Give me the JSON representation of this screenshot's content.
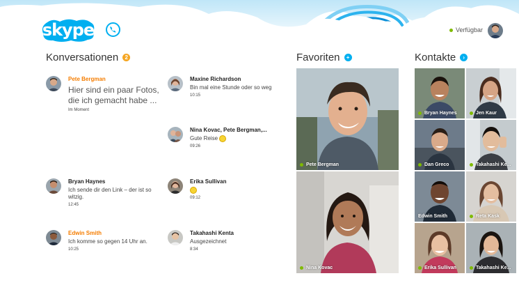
{
  "app": {
    "logo_text": "skype"
  },
  "header": {
    "status_label": "Verfügbar"
  },
  "conversations": {
    "title": "Konversationen",
    "badge": "2",
    "items": [
      {
        "name": "Pete Bergman",
        "message": "Hier sind ein paar Fotos, die ich gemacht habe ...",
        "time": "Im Moment"
      },
      {
        "name": "Maxine Richardson",
        "message": "Bin mal eine Stunde oder so weg",
        "time": "10:15"
      },
      {
        "name": "Nina Kovac, Pete Bergman,...",
        "message": "Gute Reise",
        "time": "09:26"
      },
      {
        "name": "Bryan Haynes",
        "message": "Ich sende dir den Link – der ist so witzig.",
        "time": "12:45"
      },
      {
        "name": "Erika Sullivan",
        "message": "",
        "time": "09:12"
      },
      {
        "name": "Edwin Smith",
        "message": "Ich komme so gegen 14 Uhr an.",
        "time": "10:25"
      },
      {
        "name": "Takahashi Kenta",
        "message": "Ausgezeichnet",
        "time": "8:34"
      }
    ]
  },
  "favorites": {
    "title": "Favoriten",
    "items": [
      {
        "name": "Pete Bergman"
      },
      {
        "name": "Nina Kovac"
      }
    ]
  },
  "contacts": {
    "title": "Kontakte",
    "items": [
      {
        "name": "Bryan Haynes"
      },
      {
        "name": "Jen Kaur"
      },
      {
        "name": "Dan Greco"
      },
      {
        "name": "Takahashi Ke..."
      },
      {
        "name": "Edwin Smith"
      },
      {
        "name": "Reta Kask"
      },
      {
        "name": "Erika Sullivan"
      },
      {
        "name": "Takahashi Ke..."
      }
    ]
  },
  "colors": {
    "accent": "#00aff0",
    "orange": "#f57d00",
    "online": "#7fba00"
  }
}
